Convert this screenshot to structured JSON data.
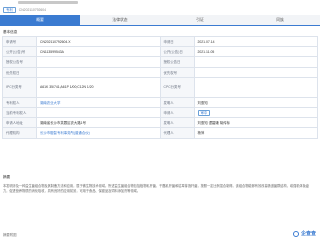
{
  "header": {
    "meta_badge": "专利",
    "meta_number": "CN202110792604"
  },
  "tabs": [
    {
      "label": "概要",
      "active": true
    },
    {
      "label": "法律状态",
      "active": false
    },
    {
      "label": "引证",
      "active": false
    },
    {
      "label": "同族",
      "active": false
    }
  ],
  "section_title": "基本信息",
  "info": {
    "rows": [
      {
        "l1": "申请号",
        "v1": "CN202110792604.X",
        "l2": "申请日",
        "v2": "2021.07.14"
      },
      {
        "l1": "公开(公告)号",
        "v1": "CN113599543A",
        "l2": "公开(公告)日",
        "v2": "2021.11.05"
      },
      {
        "l1": "授权公告号",
        "v1": "",
        "l2": "授权公告日",
        "v2": ""
      },
      {
        "l1": "优先权日",
        "v1": "",
        "l2": "优先权号",
        "v2": ""
      },
      {
        "l1": "IPC分类号",
        "v1": "A61K 35/741;A61P 1/00;C12N 1/20",
        "l2": "CPC分类号",
        "v2": ""
      },
      {
        "l1": "专利权人",
        "v1": "湖南农业大学",
        "l2": "发明人",
        "v2": "刘惠知"
      },
      {
        "l1": "当前专利权人",
        "v1": "",
        "l2": "申请人",
        "v2": "湖南农业大学"
      },
      {
        "l1": "申请人地址",
        "v1": "湖南省长沙市芙蓉区农大路1号",
        "l2": "发明人",
        "v2": "刘惠知 谭碧娥 胡传标"
      },
      {
        "l1": "代理机构",
        "v1": "长沙市融智专利事务所(普通合伙)",
        "l2": "代理人",
        "v2": "杨萍"
      }
    ],
    "status_tag": "审中"
  },
  "abstract": {
    "title": "摘要",
    "text": "本发明涉及一种益生菌组合物及其制备方法和应用，属于微生物技术领域。所述益生菌组合物包括植物乳杆菌、干酪乳杆菌和枯草芽孢杆菌，按照一定比例混合制得。该组合物能够有效改善肠道菌群结构，增强机体免疫力，促进营养物质的消化吸收，具有良好的应用前景，可用于食品、保健品及饲料添加剂等领域。"
  },
  "footer": {
    "label": "摘要附图",
    "logo_text": "企查查"
  },
  "colors": {
    "accent": "#3b7bd1",
    "label_bg": "#f5f7fa",
    "border": "#dde3ec"
  }
}
